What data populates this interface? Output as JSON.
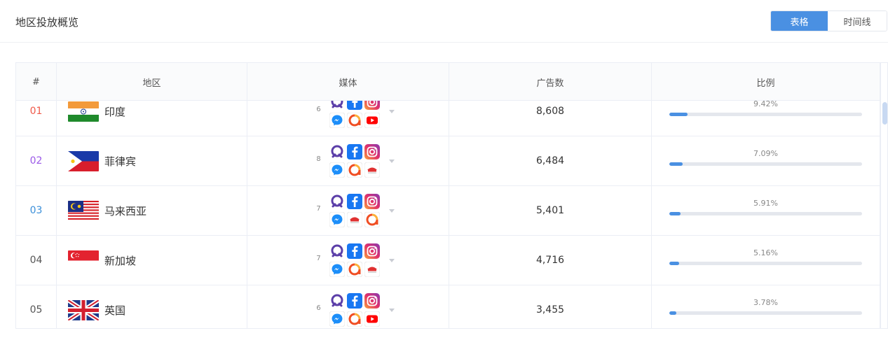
{
  "header": {
    "title": "地区投放概览",
    "view_toggle": {
      "table_label": "表格",
      "timeline_label": "时间线",
      "active": "table"
    }
  },
  "table": {
    "columns": [
      "#",
      "地区",
      "媒体",
      "广告数",
      "比例"
    ],
    "rows": [
      {
        "rank": "01",
        "rank_color": "#f05a4a",
        "flag": "india",
        "region": "印度",
        "media_count": "6",
        "media": [
          "quora-icon",
          "facebook-icon",
          "instagram-icon",
          "messenger-icon",
          "audience-network-icon",
          "youtube-icon"
        ],
        "ads": "8,608",
        "ratio_label": "9.42%",
        "ratio": 0.0942
      },
      {
        "rank": "02",
        "rank_color": "#9b59e8",
        "flag": "philippines",
        "region": "菲律宾",
        "media_count": "8",
        "media": [
          "quora-icon",
          "facebook-icon",
          "instagram-icon",
          "messenger-icon",
          "audience-network-icon",
          "other-network-icon"
        ],
        "ads": "6,484",
        "ratio_label": "7.09%",
        "ratio": 0.0709
      },
      {
        "rank": "03",
        "rank_color": "#3b8fd9",
        "flag": "malaysia",
        "region": "马来西亚",
        "media_count": "7",
        "media": [
          "quora-icon",
          "facebook-icon",
          "instagram-icon",
          "messenger-icon",
          "other-network-icon",
          "audience-network-icon"
        ],
        "ads": "5,401",
        "ratio_label": "5.91%",
        "ratio": 0.0591
      },
      {
        "rank": "04",
        "rank_color": "#555555",
        "flag": "singapore",
        "region": "新加坡",
        "media_count": "7",
        "media": [
          "quora-icon",
          "facebook-icon",
          "instagram-icon",
          "messenger-icon",
          "audience-network-icon",
          "other-network-icon"
        ],
        "ads": "4,716",
        "ratio_label": "5.16%",
        "ratio": 0.0516
      },
      {
        "rank": "05",
        "rank_color": "#555555",
        "flag": "uk",
        "region": "英国",
        "media_count": "6",
        "media": [
          "quora-icon",
          "facebook-icon",
          "instagram-icon",
          "messenger-icon",
          "audience-network-icon",
          "youtube-icon"
        ],
        "ads": "3,455",
        "ratio_label": "3.78%",
        "ratio": 0.0378
      }
    ]
  },
  "colors": {
    "accent": "#4a90e2",
    "bar_track": "#e4e7ed"
  }
}
